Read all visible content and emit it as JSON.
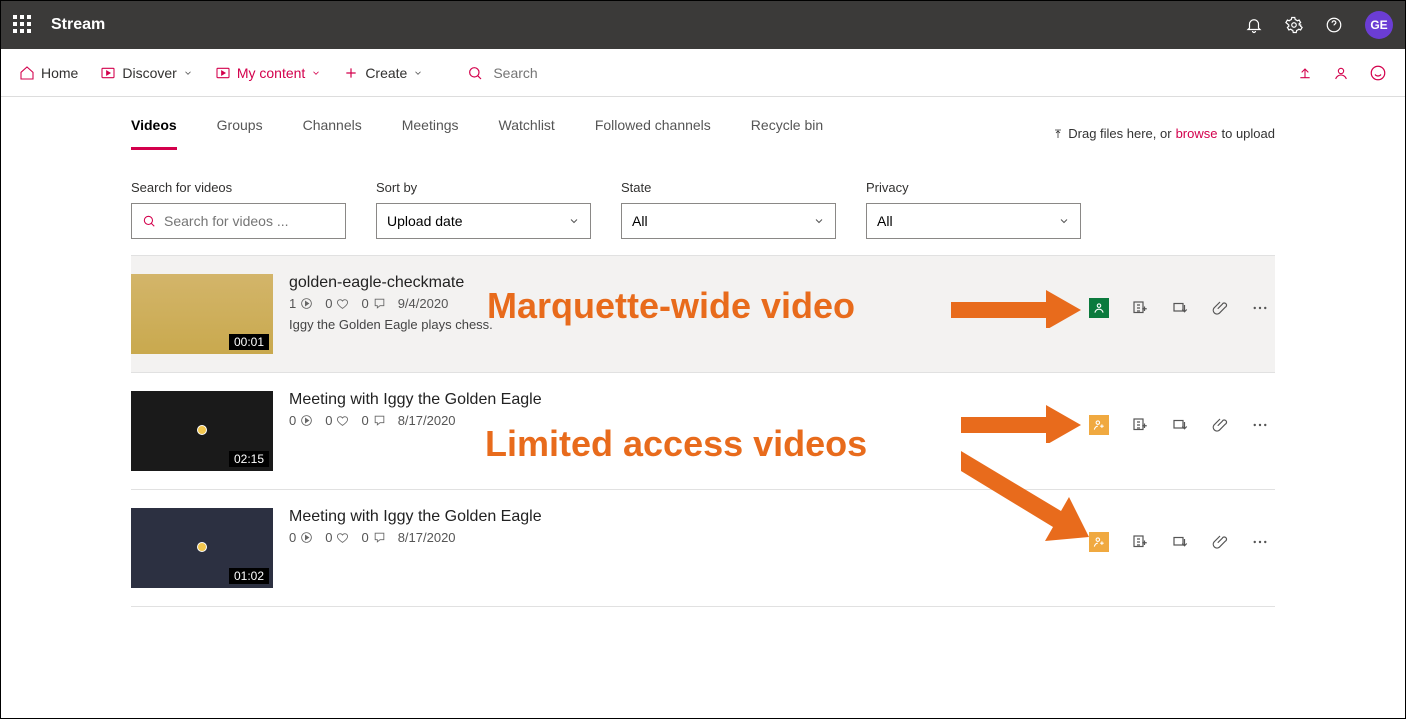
{
  "topbar": {
    "brand": "Stream",
    "avatar_initials": "GE"
  },
  "subnav": {
    "home": "Home",
    "discover": "Discover",
    "my_content": "My content",
    "create": "Create",
    "search_placeholder": "Search"
  },
  "tabs": [
    "Videos",
    "Groups",
    "Channels",
    "Meetings",
    "Watchlist",
    "Followed channels",
    "Recycle bin"
  ],
  "active_tab": "Videos",
  "upload_hint_pre": "Drag files here, or ",
  "upload_hint_browse": "browse",
  "upload_hint_post": " to upload",
  "filters": {
    "search": {
      "label": "Search for videos",
      "placeholder": "Search for videos ..."
    },
    "sort": {
      "label": "Sort by",
      "value": "Upload date"
    },
    "state": {
      "label": "State",
      "value": "All"
    },
    "privacy": {
      "label": "Privacy",
      "value": "All"
    }
  },
  "videos": [
    {
      "title": "golden-eagle-checkmate",
      "views": "1",
      "likes": "0",
      "comments": "0",
      "date": "9/4/2020",
      "duration": "00:01",
      "description": "Iggy the Golden Eagle plays chess.",
      "privacy": "org"
    },
    {
      "title": "Meeting with Iggy the Golden Eagle",
      "views": "0",
      "likes": "0",
      "comments": "0",
      "date": "8/17/2020",
      "duration": "02:15",
      "description": "",
      "privacy": "limited"
    },
    {
      "title": "Meeting with Iggy the Golden Eagle",
      "views": "0",
      "likes": "0",
      "comments": "0",
      "date": "8/17/2020",
      "duration": "01:02",
      "description": "",
      "privacy": "limited"
    }
  ],
  "annotations": {
    "wide": "Marquette-wide video",
    "limited": "Limited access videos"
  }
}
